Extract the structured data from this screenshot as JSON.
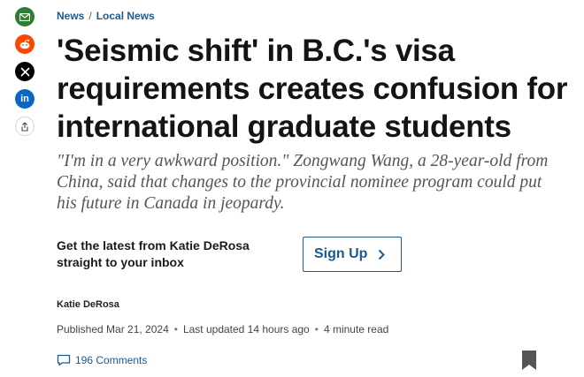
{
  "share": {
    "icons": [
      "email-icon",
      "reddit-icon",
      "x-icon",
      "linkedin-icon",
      "share-icon"
    ],
    "linkedin_glyph": "in"
  },
  "breadcrumb": {
    "news": "News",
    "separator": "/",
    "local_news": "Local News"
  },
  "article": {
    "headline": "'Seismic shift' in B.C.'s visa requirements creates confusion for international graduate students",
    "deck": "\"I'm in a very awkward position.\" Zongwang Wang, a 28-year-old from China, said that changes to the provincial nominee program could put his future in Canada in jeopardy."
  },
  "newsletter": {
    "text": "Get the latest from Katie DeRosa straight to your inbox",
    "button_label": "Sign Up"
  },
  "byline": {
    "author": "Katie DeRosa"
  },
  "meta": {
    "published": "Published Mar 21, 2024",
    "updated": "Last updated 14 hours ago",
    "read_time": "4 minute read",
    "dot": "•"
  },
  "comments": {
    "label": "196 Comments"
  },
  "colors": {
    "link": "#1c5a8f",
    "email": "#2e7d32",
    "reddit": "#ff4500",
    "x": "#000000",
    "linkedin": "#0a66c2"
  }
}
